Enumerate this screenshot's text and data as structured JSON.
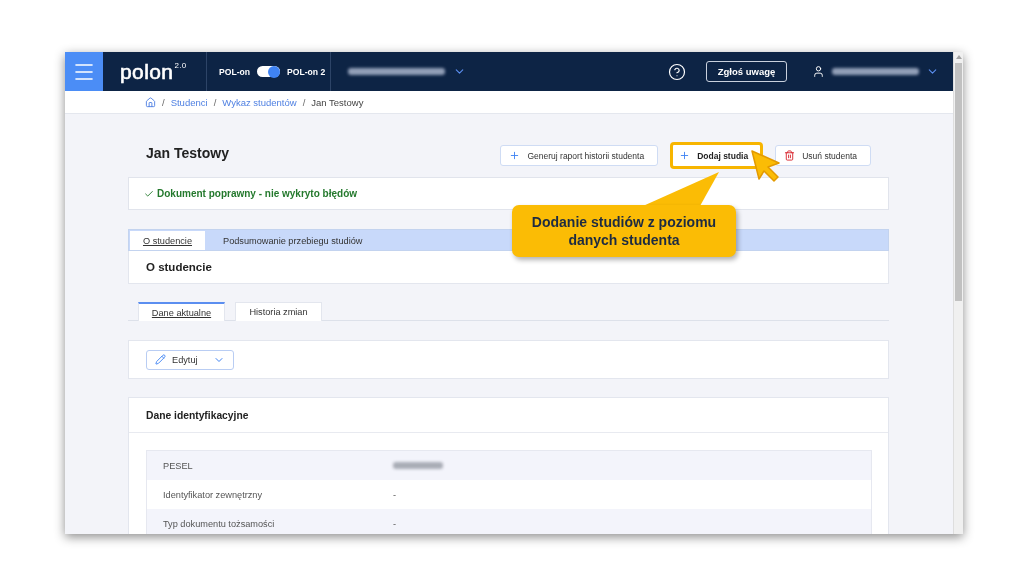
{
  "header": {
    "logo": {
      "name": "polon",
      "version": "2.0"
    },
    "system_switch": {
      "left_label": "POL-on",
      "right_label": "POL-on 2",
      "on": true
    },
    "feedback_button": "Zgłoś uwagę"
  },
  "breadcrumb": [
    {
      "separator": "/",
      "label": "Studenci",
      "current": false
    },
    {
      "separator": "/",
      "label": "Wykaz studentów",
      "current": false
    },
    {
      "separator": "/",
      "label": "Jan Testowy",
      "current": true
    }
  ],
  "page": {
    "title": "Jan Testowy",
    "actions": [
      {
        "kind": "add",
        "label": "Generuj raport historii studenta",
        "highlighted": false
      },
      {
        "kind": "add",
        "label": "Dodaj studia",
        "highlighted": true
      },
      {
        "kind": "delete",
        "label": "Usuń studenta",
        "highlighted": false
      }
    ]
  },
  "status": {
    "kind": "success",
    "text": "Dokument poprawny - nie wykryto błędów"
  },
  "tabs": [
    {
      "label": "O studencie",
      "selected": true
    },
    {
      "label": "Podsumowanie przebiegu studiów",
      "selected": false
    }
  ],
  "section": {
    "title": "O studencie",
    "subtabs": [
      {
        "label": "Dane aktualne",
        "selected": true
      },
      {
        "label": "Historia zmian",
        "selected": false
      }
    ],
    "edit_button": "Edytuj"
  },
  "identification": {
    "title": "Dane identyfikacyjne",
    "rows": [
      {
        "label": "PESEL",
        "redacted": true
      },
      {
        "label": "Identyfikator zewnętrzny",
        "value": "-",
        "redacted": false
      },
      {
        "label": "Typ dokumentu tożsamości",
        "value": "-",
        "redacted": false
      }
    ]
  },
  "callout": {
    "text": "Dodanie studiów z poziomu danych studenta"
  }
}
